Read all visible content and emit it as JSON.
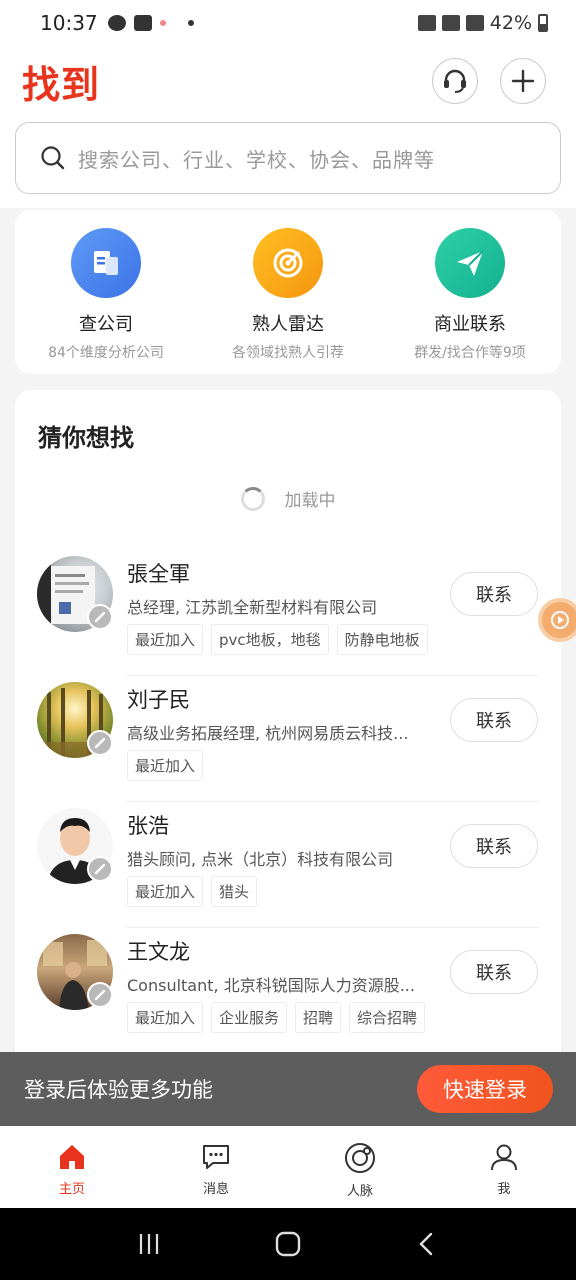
{
  "status_bar": {
    "time": "10:37",
    "battery": "42%"
  },
  "header": {
    "title": "找到"
  },
  "search": {
    "placeholder": "搜索公司、行业、学校、协会、品牌等"
  },
  "shortcuts": [
    {
      "title": "查公司",
      "subtitle": "84个维度分析公司",
      "icon": "document-icon",
      "color": "#4a86f0"
    },
    {
      "title": "熟人雷达",
      "subtitle": "各领域找熟人引荐",
      "icon": "target-icon",
      "color": "#f7a21a"
    },
    {
      "title": "商业联系",
      "subtitle": "群发/找合作等9项",
      "icon": "send-icon",
      "color": "#1fbf9b"
    }
  ],
  "recommend": {
    "title": "猜你想找",
    "loading_text": "加载中",
    "contact_label": "联系",
    "people": [
      {
        "name": "張全軍",
        "desc": "总经理, 江苏凯全新型材料有限公司",
        "tags": [
          "最近加入",
          "pvc地板，地毯",
          "防静电地板"
        ]
      },
      {
        "name": "刘子民",
        "desc": "高级业务拓展经理, 杭州网易质云科技...",
        "tags": [
          "最近加入"
        ]
      },
      {
        "name": "张浩",
        "desc": "猎头顾问, 点米（北京）科技有限公司",
        "tags": [
          "最近加入",
          "猎头"
        ]
      },
      {
        "name": "王文龙",
        "desc": "Consultant, 北京科锐国际人力资源股...",
        "tags": [
          "最近加入",
          "企业服务",
          "招聘",
          "综合招聘"
        ]
      }
    ]
  },
  "login_banner": {
    "text": "登录后体验更多功能",
    "button": "快速登录"
  },
  "tabs": [
    {
      "label": "主页",
      "icon": "home-icon",
      "active": true
    },
    {
      "label": "消息",
      "icon": "message-icon",
      "active": false
    },
    {
      "label": "人脉",
      "icon": "network-icon",
      "active": false
    },
    {
      "label": "我",
      "icon": "profile-icon",
      "active": false
    }
  ],
  "colors": {
    "brand": "#e8341c",
    "banner_bg": "#5d5d5d"
  }
}
